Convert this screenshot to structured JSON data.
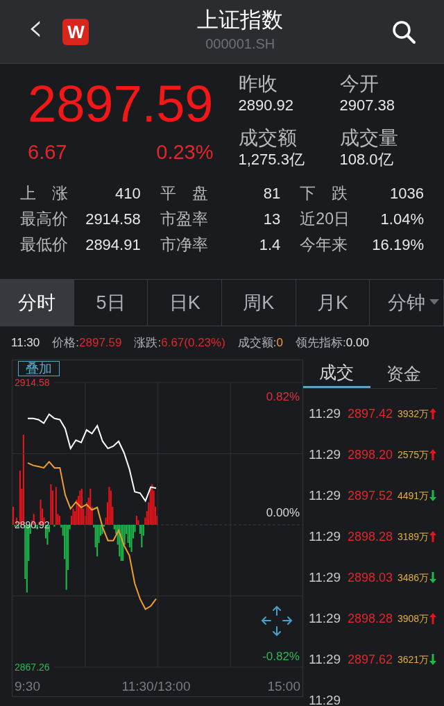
{
  "header": {
    "back_icon": "‹",
    "app_badge": "W",
    "title": "上证指数",
    "code": "000001.SH"
  },
  "quote": {
    "price": "2897.59",
    "change": "6.67",
    "change_pct": "0.23%",
    "stats": [
      {
        "label": "昨收",
        "value": "2890.92"
      },
      {
        "label": "今开",
        "value": "2907.38"
      },
      {
        "label": "成交额",
        "value": "1,275.3亿"
      },
      {
        "label": "成交量",
        "value": "108.0亿"
      }
    ]
  },
  "breadth": [
    [
      {
        "label": "上　涨",
        "value": "410"
      },
      {
        "label": "平　盘",
        "value": "81"
      },
      {
        "label": "下　跌",
        "value": "1036"
      }
    ],
    [
      {
        "label": "最高价",
        "value": "2914.58"
      },
      {
        "label": "市盈率",
        "value": "13"
      },
      {
        "label": "近20日",
        "value": "1.04%"
      }
    ],
    [
      {
        "label": "最低价",
        "value": "2894.91"
      },
      {
        "label": "市净率",
        "value": "1.4"
      },
      {
        "label": "今年来",
        "value": "16.19%"
      }
    ]
  ],
  "tabs": [
    {
      "label": "分时",
      "selected": true,
      "dropdown": false
    },
    {
      "label": "5日",
      "selected": false,
      "dropdown": false
    },
    {
      "label": "日K",
      "selected": false,
      "dropdown": false
    },
    {
      "label": "周K",
      "selected": false,
      "dropdown": false
    },
    {
      "label": "月K",
      "selected": false,
      "dropdown": false
    },
    {
      "label": "分钟",
      "selected": false,
      "dropdown": true
    }
  ],
  "info_bar": {
    "time": "11:30",
    "items": [
      {
        "label": "价格:",
        "value": "2897.59",
        "color": "#e3262b"
      },
      {
        "label": "涨跌:",
        "value": "6.67(0.23%)",
        "color": "#e3262b"
      },
      {
        "label": "成交额:",
        "value": "0",
        "color": "#f0a030"
      },
      {
        "label": "领先指标:",
        "value": "0.00",
        "color": "#e8e8e8"
      }
    ]
  },
  "overlay_button": "叠加",
  "chart": {
    "percent_labels": [
      "0.82%",
      "0.00%",
      "-0.82%"
    ],
    "chart_data": {
      "type": "line",
      "categories": [
        "9:30",
        null,
        null,
        null,
        null,
        null,
        null,
        null,
        null,
        null,
        null,
        null,
        null,
        null,
        null,
        null,
        null,
        null,
        null,
        null,
        null,
        null,
        null,
        null,
        "11:30/13:00",
        null,
        null,
        null,
        null,
        null,
        null,
        null,
        null,
        null,
        null,
        null,
        null,
        null,
        null,
        null,
        null,
        null,
        null,
        null,
        null,
        null,
        null,
        null,
        "15:00"
      ],
      "ylim": [
        2867.26,
        2914.58
      ],
      "yticks": [
        {
          "value": 2914.58,
          "label": "2914.58"
        },
        {
          "value": 2890.92,
          "label": "2890.92"
        },
        {
          "value": 2867.26,
          "label": "2867.26"
        }
      ],
      "series": [
        {
          "color": "#ffffff",
          "values": [
            2908.6,
            2908.6,
            2908.4,
            2907.8,
            2909.3,
            2908.6,
            2908.4,
            2906.9,
            2903.6,
            2905.0,
            2904.6,
            2906.7,
            2906.1,
            2907.4,
            2904.8,
            2903.6,
            2904.0,
            2904.8,
            2902.9,
            2900.2,
            2896.4,
            2896.2,
            2894.9,
            2897.2,
            2897.0,
            null,
            null,
            null,
            null,
            null,
            null,
            null,
            null,
            null,
            null,
            null,
            null,
            null,
            null,
            null,
            null,
            null,
            null,
            null,
            null,
            null,
            null,
            null,
            null
          ]
        },
        {
          "color": "#f0a030",
          "values": [
            2901.2,
            2900.8,
            2900.6,
            2900.4,
            2901.4,
            2900.4,
            2900.4,
            2895.9,
            2893.6,
            2894.7,
            2893.8,
            2894.3,
            2893.4,
            2893.8,
            2890.5,
            2888.3,
            2888.3,
            2890.0,
            2887.5,
            2885.8,
            2881.2,
            2878.6,
            2876.9,
            2877.4,
            2878.6,
            null,
            null,
            null,
            null,
            null,
            null,
            null,
            null,
            null,
            null,
            null,
            null,
            null,
            null,
            null,
            null,
            null,
            null,
            null,
            null,
            null,
            null,
            null,
            null
          ]
        }
      ]
    }
  },
  "trade_tabs": [
    {
      "label": "成交",
      "selected": true
    },
    {
      "label": "资金",
      "selected": false
    }
  ],
  "trades": [
    {
      "time": "11:29",
      "price": "2897.42",
      "volume": "3932万",
      "rising": true
    },
    {
      "time": "11:29",
      "price": "2898.20",
      "volume": "2575万",
      "rising": true
    },
    {
      "time": "11:29",
      "price": "2897.52",
      "volume": "4491万",
      "rising": false
    },
    {
      "time": "11:29",
      "price": "2898.28",
      "volume": "3189万",
      "rising": true
    },
    {
      "time": "11:29",
      "price": "2898.03",
      "volume": "3486万",
      "rising": false
    },
    {
      "time": "11:29",
      "price": "2898.28",
      "volume": "3908万",
      "rising": true
    },
    {
      "time": "11:29",
      "price": "2897.62",
      "volume": "3621万",
      "rising": false
    },
    {
      "time": "11:29"
    }
  ]
}
